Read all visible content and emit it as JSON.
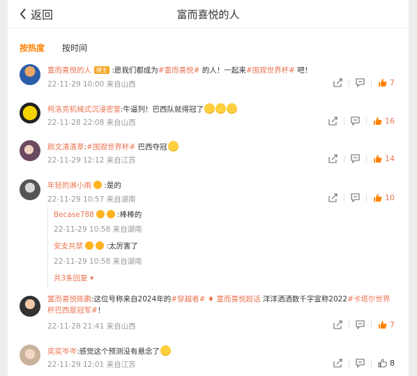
{
  "header": {
    "back_label": "返回",
    "title": "富而喜悦的人"
  },
  "tabs": [
    {
      "label": "按热度",
      "active": true
    },
    {
      "label": "按时间",
      "active": false
    }
  ],
  "colors": {
    "accent": "#ff8200",
    "link": "#eb7350"
  },
  "comments": [
    {
      "user": "富而喜悦的人",
      "badge": "楼主",
      "pre": " :愿我们都成为",
      "tag1": "#富而喜悦#",
      "mid": " 的人！一起来",
      "tag2": "#围观世界杯#",
      "post": " 吧！",
      "time": "22-11-29 10:00 来自山西",
      "likes": "7"
    },
    {
      "user": "柯洛克机械式沉浸密室",
      "text": ":牛逼列！巴西队就得冠了",
      "time": "22-11-28 22:08 来自山西",
      "likes": "16"
    },
    {
      "user": "颜文清清草",
      "pre": ":",
      "tag1": "#围观世界杯#",
      "post": " 巴西夺冠",
      "time": "22-11-29 12:12 来自江苏",
      "likes": "14"
    },
    {
      "user": "年轻的淋小雨",
      "text": " :是的",
      "time": "22-11-29 10:57 来自湖南",
      "likes": "10",
      "replies": [
        {
          "user": "Becase788",
          "text": " :棒棒的",
          "time": "22-11-29 10:58 来自湖南"
        },
        {
          "user": "安支共禁",
          "text": " :太厉害了",
          "time": "22-11-29 10:58 来自湖南"
        }
      ],
      "more": "共3条回复"
    },
    {
      "user": "富而喜悦陈鹏",
      "pre": ":这位号称来自2024年的",
      "tag1": "#穿越者#",
      "mid": " ",
      "tag2": "富而喜悦超话",
      "post": " 洋洋洒洒数千字宣称2022",
      "tag3": "#卡塔尔世界杯巴西是冠军#",
      "end": "！",
      "time": "22-11-28 21:41 来自山西",
      "likes": "7"
    },
    {
      "user": "奕奕岑岑",
      "text": ":感觉这个预测没有悬念了",
      "time": "22-11-29 12:01 来自江苏",
      "likes": "8"
    }
  ]
}
